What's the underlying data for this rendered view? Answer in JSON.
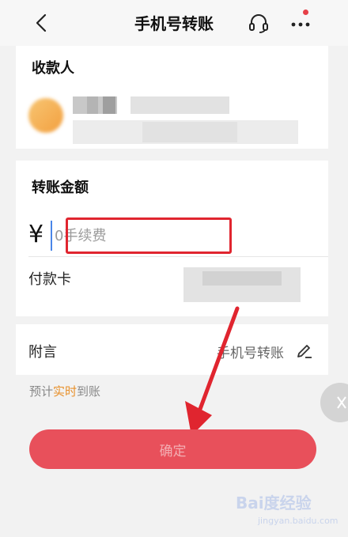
{
  "header": {
    "title": "手机号转账",
    "icons": [
      "back-icon",
      "headset-icon",
      "more-icon"
    ],
    "notification_dot_color": "#e64048"
  },
  "payee": {
    "section_title": "收款人"
  },
  "amount": {
    "section_title": "转账金额",
    "currency_symbol": "¥",
    "placeholder": "0手续费",
    "pay_card_label": "付款卡"
  },
  "note": {
    "label": "附言",
    "value": "手机号转账"
  },
  "eta": {
    "prefix": "预计",
    "highlight": "实时",
    "suffix": "到账",
    "highlight_color": "#e8902a"
  },
  "confirm_button": {
    "label": "确定",
    "color": "#e8505b"
  },
  "watermark": {
    "main": "Bai度经验",
    "sub": "jingyan.baidu.com"
  },
  "annotation_color": "#e0252f"
}
